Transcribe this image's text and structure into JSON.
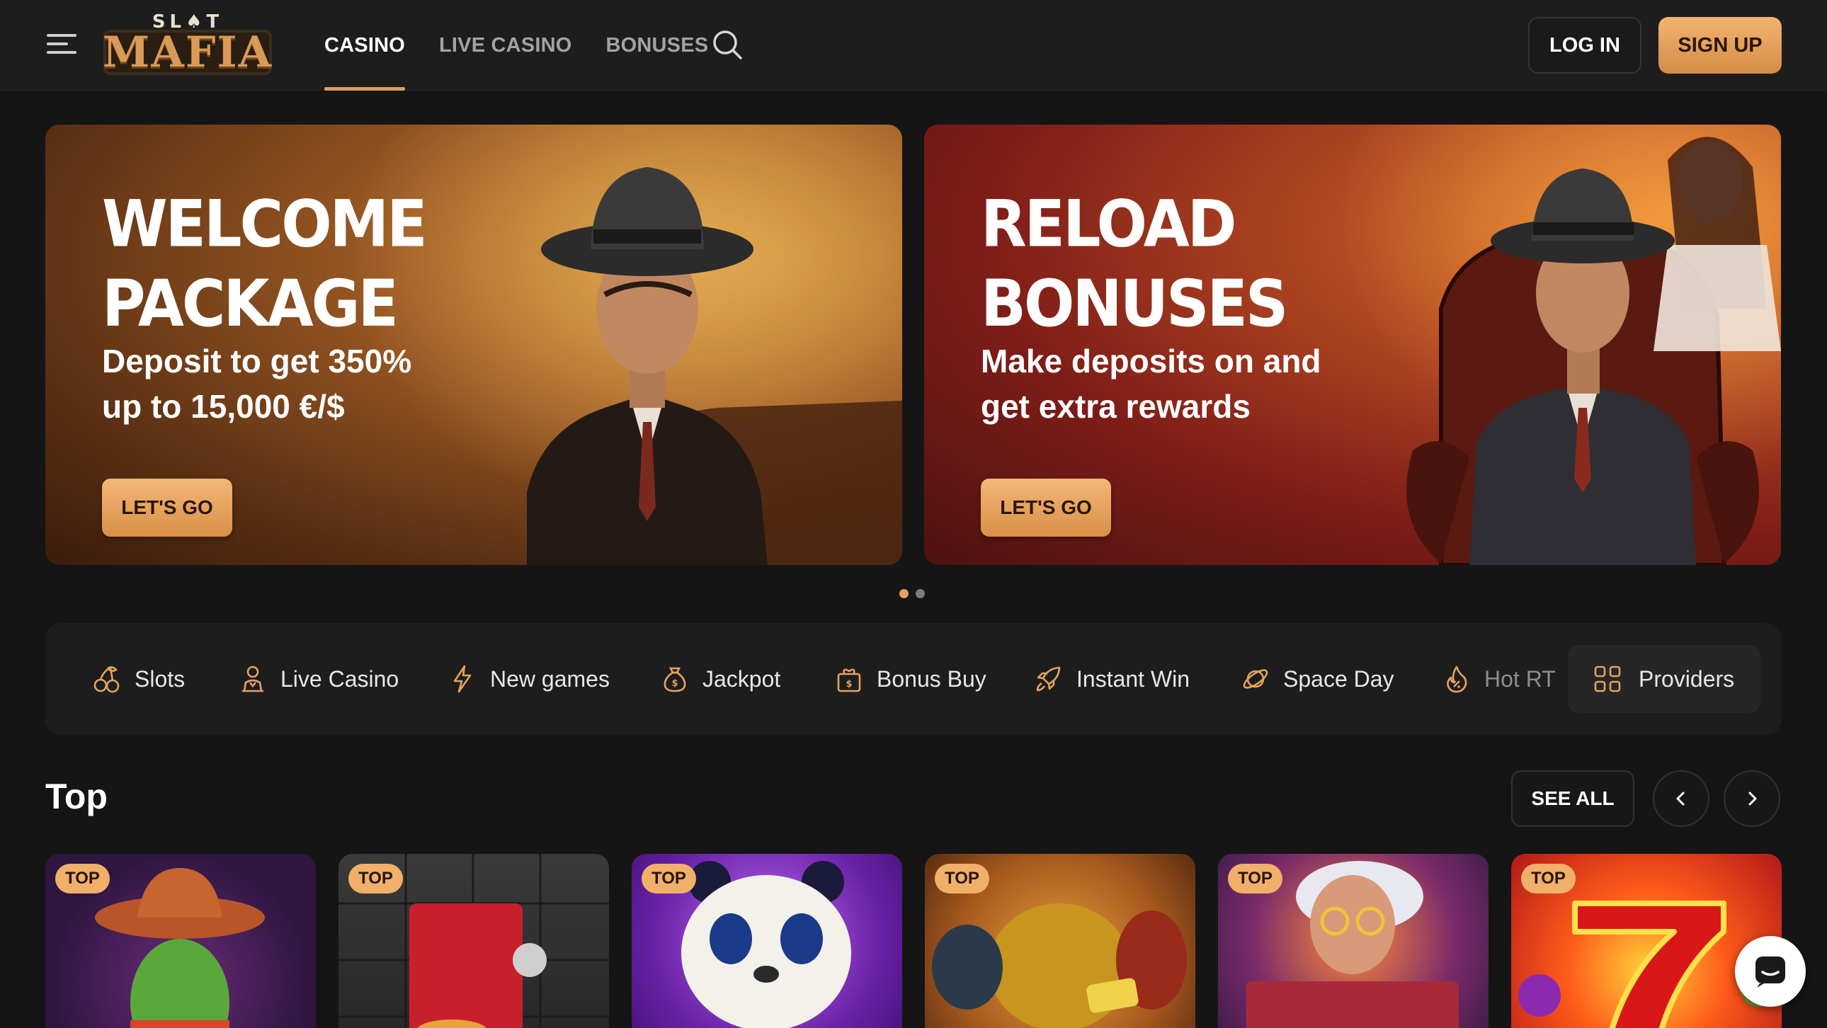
{
  "header": {
    "logo_top": "SL♠T",
    "logo_main": "MAFIA",
    "nav": [
      {
        "label": "CASINO",
        "active": true
      },
      {
        "label": "LIVE CASINO",
        "active": false
      },
      {
        "label": "BONUSES",
        "active": false
      }
    ],
    "login_label": "LOG IN",
    "signup_label": "SIGN UP"
  },
  "banners": [
    {
      "title_line1": "WELCOME",
      "title_line2": "PACKAGE",
      "text_line1": "Deposit to get 350%",
      "text_line2": "up to 15,000 €/$",
      "cta": "LET'S GO"
    },
    {
      "title_line1": "RELOAD",
      "title_line2": "BONUSES",
      "text_line1": "Make deposits on and",
      "text_line2": "get extra rewards",
      "cta": "LET'S GO"
    }
  ],
  "carousel": {
    "count": 2,
    "active_index": 0
  },
  "categories": [
    {
      "label": "Slots",
      "icon": "cherries-icon"
    },
    {
      "label": "Live Casino",
      "icon": "dealer-icon"
    },
    {
      "label": "New games",
      "icon": "lightning-icon"
    },
    {
      "label": "Jackpot",
      "icon": "money-bag-icon"
    },
    {
      "label": "Bonus Buy",
      "icon": "gift-bag-icon"
    },
    {
      "label": "Instant Win",
      "icon": "rocket-icon"
    },
    {
      "label": "Space Day",
      "icon": "planet-icon"
    },
    {
      "label": "Hot RT",
      "icon": "flame-icon"
    }
  ],
  "providers_label": "Providers",
  "top_section": {
    "title": "Top",
    "see_all": "SEE ALL",
    "games": [
      {
        "badge": "TOP"
      },
      {
        "badge": "TOP"
      },
      {
        "badge": "TOP"
      },
      {
        "badge": "TOP"
      },
      {
        "badge": "TOP"
      },
      {
        "badge": "TOP"
      }
    ]
  },
  "colors": {
    "accent": "#dc9d5b",
    "background": "#151515",
    "header": "#1d1d1d"
  }
}
